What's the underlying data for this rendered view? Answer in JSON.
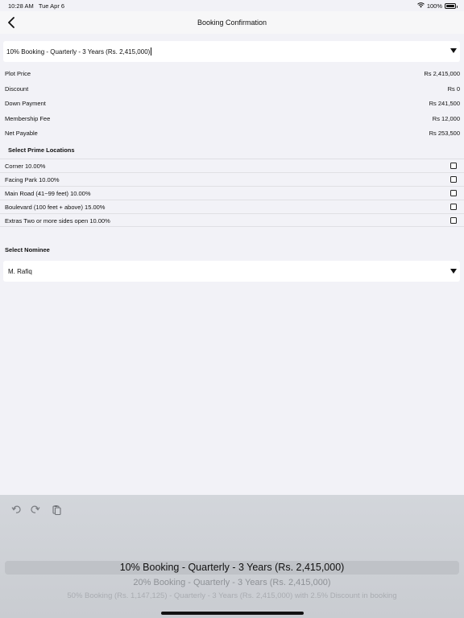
{
  "status_bar": {
    "time": "10:28 AM",
    "date": "Tue Apr 6",
    "battery": "100%",
    "battery_level": 1.0
  },
  "nav": {
    "title": "Booking Confirmation"
  },
  "plan_select": {
    "value": "10% Booking - Quarterly - 3 Years (Rs. 2,415,000)"
  },
  "summary": [
    {
      "label": "Plot Price",
      "value": "Rs 2,415,000"
    },
    {
      "label": "Discount",
      "value": "Rs 0"
    },
    {
      "label": "Down Payment",
      "value": "Rs 241,500"
    },
    {
      "label": "Membership Fee",
      "value": "Rs 12,000"
    },
    {
      "label": "Net Payable",
      "value": "Rs 253,500"
    }
  ],
  "prime_locations": {
    "heading": "Select Prime Locations",
    "items": [
      {
        "label": "Corner 10.00%",
        "checked": false
      },
      {
        "label": "Facing Park 10.00%",
        "checked": false
      },
      {
        "label": "Main Road (41~99 feet) 10.00%",
        "checked": false
      },
      {
        "label": "Boulevard (100 feet + above) 15.00%",
        "checked": false
      },
      {
        "label": "Extras Two or more sides open 10.00%",
        "checked": false
      }
    ]
  },
  "nominee": {
    "heading": "Select Nominee",
    "value": "M. Rafiq"
  },
  "keyboard": {
    "suggestions": [
      "10% Booking - Quarterly - 3 Years (Rs. 2,415,000)",
      "20% Booking - Quarterly - 3 Years (Rs. 2,415,000)",
      "50% Booking (Rs. 1,147,125) - Quarterly - 3 Years (Rs. 2,415,000) with 2.5% Discount in booking"
    ]
  },
  "colors": {
    "background": "#f2f2f7",
    "card": "#ffffff",
    "keyboard": "#d1d4d9"
  }
}
